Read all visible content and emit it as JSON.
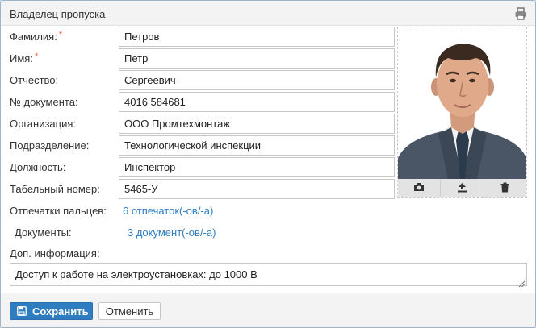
{
  "header": {
    "title": "Владелец пропуска",
    "icon": "print-icon"
  },
  "form": {
    "fields": [
      {
        "label": "Фамилия:",
        "required": "*",
        "value": "Петров"
      },
      {
        "label": "Имя:",
        "required": "*",
        "value": "Петр"
      },
      {
        "label": "Отчество:",
        "value": "Сергеевич"
      },
      {
        "label": "№ документа:",
        "value": "4016 584681"
      },
      {
        "label": "Организация:",
        "value": "ООО Промтехмонтаж"
      },
      {
        "label": "Подразделение:",
        "value": "Технологической инспекции"
      },
      {
        "label": "Должность:",
        "value": "Инспектор"
      },
      {
        "label": "Табельный номер:",
        "value": "5465-У"
      }
    ],
    "fingerprints": {
      "label": "Отпечатки пальцев:",
      "link": "6 отпечаток(-ов/-а)"
    },
    "documents": {
      "label": "Документы:",
      "link": "3 документ(-ов/-а)"
    },
    "notes": {
      "label": "Доп. информация:",
      "value": "Доступ к работе на электроустановках: до 1000 В"
    }
  },
  "photo": {
    "toolbar_icons": [
      "camera-icon",
      "upload-icon",
      "trash-icon"
    ]
  },
  "footer": {
    "save_label": "Сохранить",
    "cancel_label": "Отменить"
  },
  "colors": {
    "accent": "#2f7dc1",
    "required": "#e0552b",
    "link": "#2f7dc1"
  }
}
